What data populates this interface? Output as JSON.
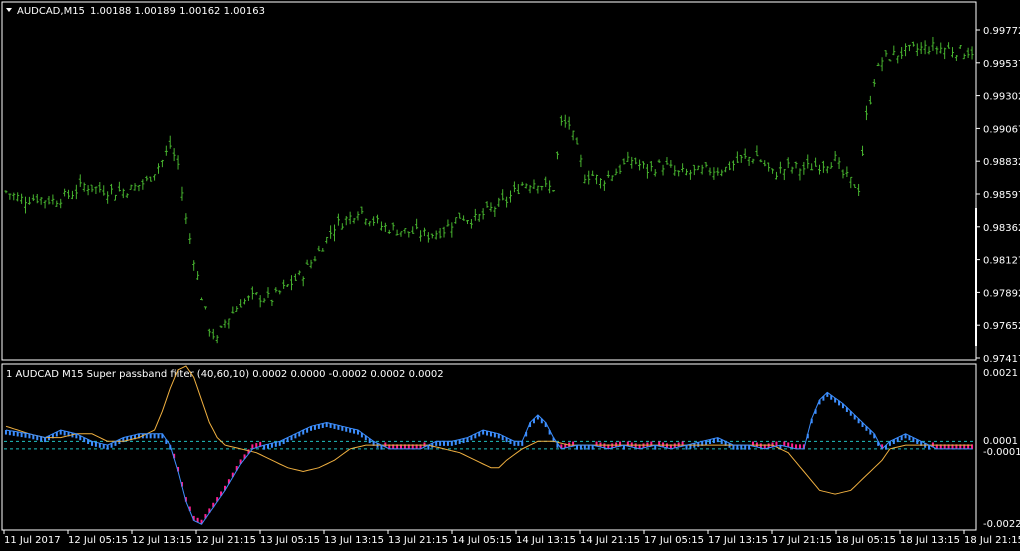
{
  "header": {
    "symbol_label": "AUDCAD,M15",
    "ohlc": "1.00188 1.00189 1.00162 1.00163"
  },
  "indicator": {
    "title": "1 AUDCAD M15 Super passband filter (40,60,10) 0.0002 0.0000 -0.0002 0.0002 0.0002"
  },
  "colors": {
    "background": "#000000",
    "frame": "#ffffff",
    "bars": "#47b32f",
    "filter_up": "#3d8fff",
    "filter_down": "#ff1f8f",
    "signal": "#f0b040",
    "levels": "#20c0c0"
  },
  "chart_data": [
    {
      "type": "ohlc",
      "title": "AUDCAD,M15",
      "y_ticks": [
        "0.99772",
        "0.99537",
        "0.99302",
        "0.99067",
        "0.98832",
        "0.98597",
        "0.98362",
        "0.98127",
        "0.97892",
        "0.97652",
        "0.97417"
      ],
      "ylim": [
        0.97417,
        1.00189
      ],
      "x_ticks": [
        "11 Jul 2017",
        "12 Jul 05:15",
        "12 Jul 13:15",
        "12 Jul 21:15",
        "13 Jul 05:15",
        "13 Jul 13:15",
        "13 Jul 21:15",
        "14 Jul 05:15",
        "14 Jul 13:15",
        "14 Jul 21:15",
        "17 Jul 05:15",
        "17 Jul 13:15",
        "17 Jul 21:15",
        "18 Jul 05:15",
        "18 Jul 13:15",
        "18 Jul 21:15"
      ],
      "close_path": [
        [
          0,
          0.9872
        ],
        [
          4,
          0.9866
        ],
        [
          8,
          0.9867
        ],
        [
          12,
          0.9865
        ],
        [
          16,
          0.9869
        ],
        [
          20,
          0.9877
        ],
        [
          24,
          0.9874
        ],
        [
          28,
          0.9872
        ],
        [
          32,
          0.9874
        ],
        [
          36,
          0.988
        ],
        [
          40,
          0.9896
        ],
        [
          42,
          0.9908
        ],
        [
          44,
          0.9893
        ],
        [
          46,
          0.985
        ],
        [
          48,
          0.982
        ],
        [
          50,
          0.979
        ],
        [
          52,
          0.9765
        ],
        [
          54,
          0.9755
        ],
        [
          56,
          0.977
        ],
        [
          60,
          0.9785
        ],
        [
          64,
          0.979
        ],
        [
          68,
          0.9788
        ],
        [
          72,
          0.9798
        ],
        [
          76,
          0.9808
        ],
        [
          80,
          0.9825
        ],
        [
          84,
          0.9845
        ],
        [
          88,
          0.9852
        ],
        [
          90,
          0.9858
        ],
        [
          92,
          0.9854
        ],
        [
          96,
          0.9845
        ],
        [
          100,
          0.9842
        ],
        [
          104,
          0.984
        ],
        [
          108,
          0.9838
        ],
        [
          112,
          0.9842
        ],
        [
          116,
          0.9853
        ],
        [
          120,
          0.985
        ],
        [
          124,
          0.9858
        ],
        [
          128,
          0.9865
        ],
        [
          132,
          0.9878
        ],
        [
          136,
          0.988
        ],
        [
          138,
          0.9875
        ],
        [
          140,
          0.9875
        ],
        [
          142,
          0.9925
        ],
        [
          144,
          0.9925
        ],
        [
          146,
          0.9905
        ],
        [
          148,
          0.9885
        ],
        [
          150,
          0.9885
        ],
        [
          152,
          0.988
        ],
        [
          156,
          0.9888
        ],
        [
          160,
          0.9897
        ],
        [
          164,
          0.9889
        ],
        [
          168,
          0.9893
        ],
        [
          172,
          0.9886
        ],
        [
          176,
          0.9887
        ],
        [
          180,
          0.9889
        ],
        [
          184,
          0.989
        ],
        [
          188,
          0.9897
        ],
        [
          192,
          0.99
        ],
        [
          196,
          0.9886
        ],
        [
          200,
          0.9891
        ],
        [
          204,
          0.989
        ],
        [
          208,
          0.9893
        ],
        [
          212,
          0.9897
        ],
        [
          214,
          0.9885
        ],
        [
          216,
          0.988
        ],
        [
          218,
          0.9875
        ],
        [
          220,
          0.993
        ],
        [
          222,
          0.996
        ],
        [
          224,
          0.9975
        ],
        [
          228,
          0.998
        ],
        [
          232,
          0.9983
        ],
        [
          236,
          0.9985
        ],
        [
          240,
          0.9984
        ],
        [
          242,
          0.9983
        ],
        [
          244,
          0.9982
        ],
        [
          247,
          0.9982
        ]
      ]
    },
    {
      "type": "line",
      "title": "1 AUDCAD M15 Super passband filter (40,60,10) 0.0002 0.0000 -0.0002 0.0002 0.0002",
      "y_ticks": [
        "0.0021",
        "0.0001",
        "-0.0001",
        "-0.0022"
      ],
      "ylim": [
        -0.0022,
        0.0021
      ],
      "levels": [
        0.0001,
        -0.0001
      ],
      "series": [
        {
          "values": [
            [
              0,
              0.0004
            ],
            [
              6,
              0.0003
            ],
            [
              10,
              0.0002
            ],
            [
              14,
              0.0004
            ],
            [
              18,
              0.0003
            ],
            [
              22,
              0.0001
            ],
            [
              26,
              0.0
            ],
            [
              30,
              0.0002
            ],
            [
              34,
              0.0003
            ],
            [
              38,
              0.0003
            ],
            [
              40,
              0.0003
            ],
            [
              42,
              0.0
            ],
            [
              44,
              -0.0007
            ],
            [
              46,
              -0.0015
            ],
            [
              48,
              -0.002
            ],
            [
              50,
              -0.0021
            ],
            [
              52,
              -0.0018
            ],
            [
              56,
              -0.0012
            ],
            [
              60,
              -0.0005
            ],
            [
              63,
              -0.0001
            ],
            [
              66,
              0.0
            ],
            [
              70,
              0.0001
            ],
            [
              74,
              0.0003
            ],
            [
              78,
              0.0005
            ],
            [
              82,
              0.0006
            ],
            [
              86,
              0.0005
            ],
            [
              90,
              0.0004
            ],
            [
              94,
              0.0001
            ],
            [
              98,
              -0.0001
            ],
            [
              102,
              -0.0001
            ],
            [
              106,
              -0.0001
            ],
            [
              110,
              0.0001
            ],
            [
              114,
              0.0001
            ],
            [
              118,
              0.0002
            ],
            [
              122,
              0.0004
            ],
            [
              126,
              0.0003
            ],
            [
              130,
              0.0001
            ],
            [
              132,
              0.0001
            ],
            [
              134,
              0.0006
            ],
            [
              136,
              0.0008
            ],
            [
              138,
              0.0006
            ],
            [
              140,
              0.0002
            ],
            [
              142,
              -0.0001
            ],
            [
              146,
              0.0
            ],
            [
              150,
              0.0
            ],
            [
              154,
              -0.0001
            ],
            [
              158,
              0.0
            ],
            [
              162,
              -0.0001
            ],
            [
              166,
              0.0
            ],
            [
              170,
              -0.0001
            ],
            [
              174,
              0.0
            ],
            [
              178,
              0.0001
            ],
            [
              182,
              0.0002
            ],
            [
              186,
              0.0
            ],
            [
              190,
              0.0
            ],
            [
              194,
              -0.0001
            ],
            [
              198,
              0.0
            ],
            [
              202,
              -0.0001
            ],
            [
              204,
              -0.0001
            ],
            [
              206,
              0.0007
            ],
            [
              208,
              0.0012
            ],
            [
              210,
              0.0014
            ],
            [
              214,
              0.0011
            ],
            [
              218,
              0.0007
            ],
            [
              222,
              0.0003
            ],
            [
              224,
              -0.0001
            ],
            [
              226,
              0.0001
            ],
            [
              230,
              0.0003
            ],
            [
              234,
              0.0001
            ],
            [
              238,
              -0.0001
            ],
            [
              242,
              -0.0001
            ]
          ]
        },
        {
          "values": [
            [
              0,
              0.0005
            ],
            [
              6,
              0.0003
            ],
            [
              10,
              0.0002
            ],
            [
              14,
              0.0002
            ],
            [
              18,
              0.0003
            ],
            [
              22,
              0.0003
            ],
            [
              26,
              0.0001
            ],
            [
              30,
              0.0001
            ],
            [
              34,
              0.0002
            ],
            [
              38,
              0.0004
            ],
            [
              40,
              0.0009
            ],
            [
              42,
              0.0015
            ],
            [
              44,
              0.002
            ],
            [
              46,
              0.0021
            ],
            [
              48,
              0.0018
            ],
            [
              50,
              0.0012
            ],
            [
              52,
              0.0006
            ],
            [
              54,
              0.0002
            ],
            [
              56,
              0.0
            ],
            [
              60,
              -0.0001
            ],
            [
              64,
              -0.0002
            ],
            [
              68,
              -0.0004
            ],
            [
              72,
              -0.0006
            ],
            [
              76,
              -0.0007
            ],
            [
              80,
              -0.0006
            ],
            [
              84,
              -0.0004
            ],
            [
              88,
              -0.0001
            ],
            [
              92,
              0.0
            ],
            [
              96,
              0.0
            ],
            [
              100,
              0.0
            ],
            [
              104,
              0.0
            ],
            [
              108,
              0.0
            ],
            [
              112,
              -0.0001
            ],
            [
              116,
              -0.0002
            ],
            [
              120,
              -0.0004
            ],
            [
              124,
              -0.0006
            ],
            [
              126,
              -0.0006
            ],
            [
              128,
              -0.0004
            ],
            [
              132,
              -0.0001
            ],
            [
              136,
              0.0001
            ],
            [
              140,
              0.0001
            ],
            [
              144,
              0.0
            ],
            [
              148,
              0.0
            ],
            [
              152,
              0.0
            ],
            [
              156,
              0.0
            ],
            [
              160,
              0.0
            ],
            [
              164,
              0.0
            ],
            [
              168,
              0.0
            ],
            [
              172,
              0.0
            ],
            [
              176,
              0.0
            ],
            [
              180,
              0.0
            ],
            [
              184,
              0.0
            ],
            [
              188,
              0.0
            ],
            [
              192,
              0.0
            ],
            [
              196,
              0.0
            ],
            [
              200,
              -0.0002
            ],
            [
              204,
              -0.0007
            ],
            [
              208,
              -0.0012
            ],
            [
              212,
              -0.0013
            ],
            [
              216,
              -0.0012
            ],
            [
              220,
              -0.0008
            ],
            [
              224,
              -0.0004
            ],
            [
              226,
              -0.0001
            ],
            [
              230,
              0.0
            ],
            [
              234,
              0.0
            ],
            [
              238,
              0.0
            ],
            [
              242,
              0.0
            ]
          ]
        }
      ]
    }
  ]
}
